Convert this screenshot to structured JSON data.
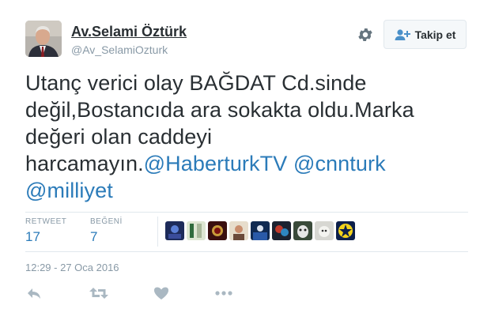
{
  "user": {
    "display_name": "Av.Selami Öztürk",
    "screen_name": "@Av_SelamiOzturk"
  },
  "follow_button": {
    "label": "Takip et",
    "icon": "user-plus-icon"
  },
  "settings": {
    "icon": "gear-icon"
  },
  "tweet": {
    "lines": [
      [
        {
          "text": "Utanç verici olay BAĞDAT Cd.sinde"
        }
      ],
      [
        {
          "text": "değil,Bostancıda ara sokakta oldu.Marka"
        }
      ],
      [
        {
          "text": "değeri olan caddeyi"
        }
      ],
      [
        {
          "text": "harcamayın."
        },
        {
          "text": "@HaberturkTV",
          "mention": true
        },
        {
          "text": " "
        },
        {
          "text": "@cnnturk",
          "mention": true
        }
      ],
      [
        {
          "text": "@milliyet",
          "mention": true
        }
      ]
    ]
  },
  "stats": {
    "retweet_label": "RETWEET",
    "retweet_count": "17",
    "likes_label": "BEĞENİ",
    "likes_count": "7"
  },
  "timestamp": "12:29 - 27 Oca 2016",
  "actions": [
    "reply-icon",
    "retweet-icon",
    "like-icon",
    "more-icon"
  ],
  "colors": {
    "link": "#2b7bb9",
    "text": "#292f33",
    "muted": "#8899a6",
    "action_icon": "#aab8c2"
  }
}
